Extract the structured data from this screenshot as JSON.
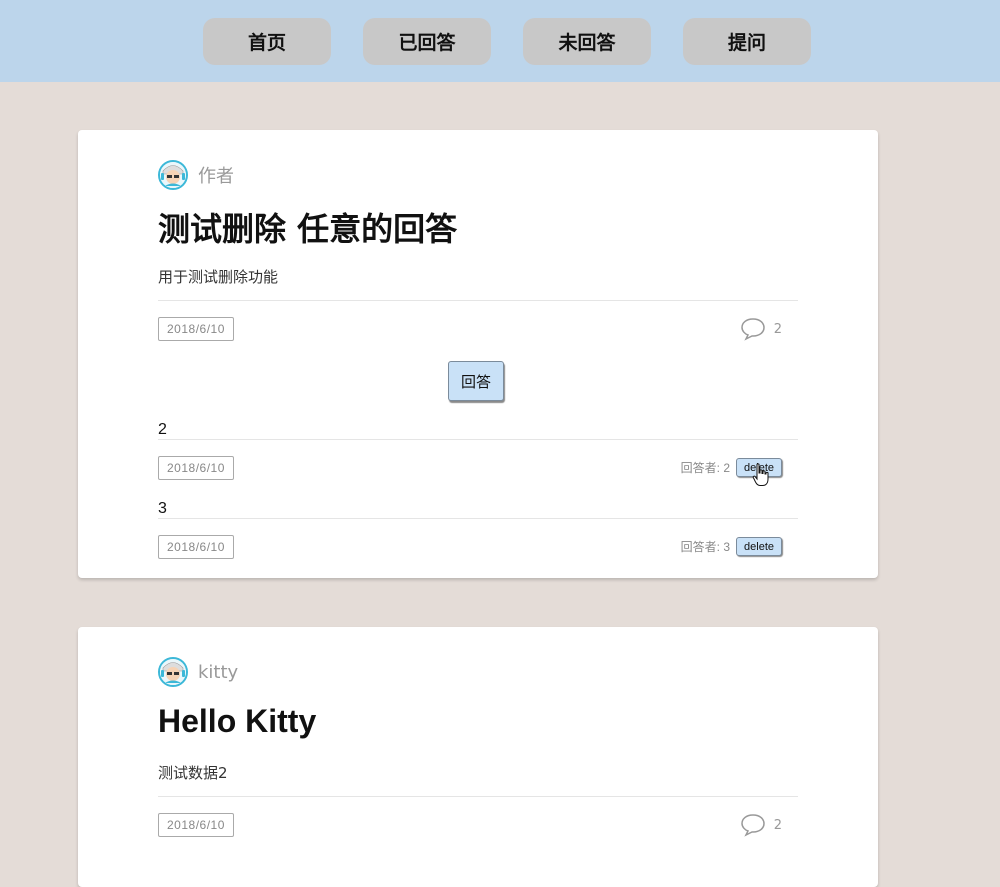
{
  "nav": {
    "home": "首页",
    "answered": "已回答",
    "unanswered": "未回答",
    "ask": "提问"
  },
  "questions": [
    {
      "author": "作者",
      "title": "测试删除 任意的回答",
      "description": "用于测试删除功能",
      "date": "2018/6/10",
      "comment_count": "2",
      "answer_button": "回答",
      "answers": [
        {
          "text": "2",
          "date": "2018/6/10",
          "answerer": "回答者: 2",
          "delete_label": "delete"
        },
        {
          "text": "3",
          "date": "2018/6/10",
          "answerer": "回答者: 3",
          "delete_label": "delete"
        }
      ]
    },
    {
      "author": "kitty",
      "title": "Hello Kitty",
      "description": "测试数据2",
      "date": "2018/6/10",
      "comment_count": "2"
    }
  ],
  "colors": {
    "topbar": "#bcd5eb",
    "page_bg": "#e4dcd7",
    "button_bg": "#c9e1f7",
    "nav_button": "#c8c8c8"
  }
}
